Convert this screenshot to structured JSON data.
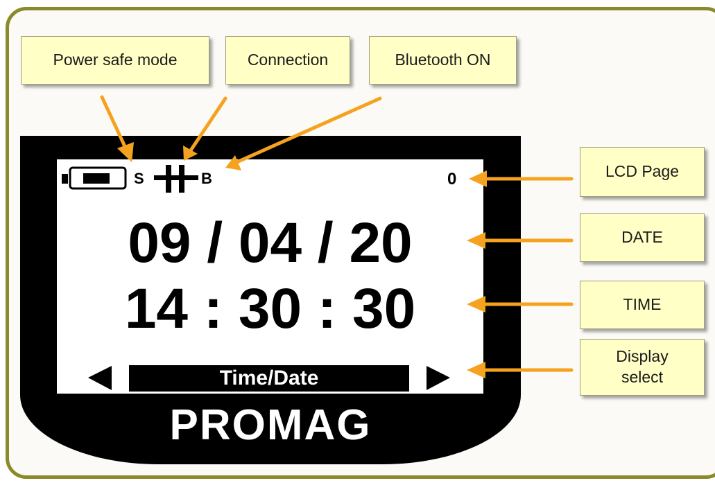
{
  "callouts": {
    "power_safe": "Power safe mode",
    "connection": "Connection",
    "bluetooth": "Bluetooth ON",
    "lcd_page": "LCD Page",
    "date": "DATE",
    "time": "TIME",
    "display_select_line1": "Display",
    "display_select_line2": "select"
  },
  "lcd": {
    "power_indicator": "S",
    "bluetooth_indicator": "B",
    "page_number": "0",
    "date_value": "09 / 04 / 20",
    "time_value": "14 : 30 : 30",
    "display_mode": "Time/Date"
  },
  "device": {
    "brand": "PROMAG"
  },
  "colors": {
    "arrow": "#f5a21e",
    "callout_fill": "#ffffc6",
    "frame_border": "#8a8a2a",
    "device_body": "#000000"
  }
}
